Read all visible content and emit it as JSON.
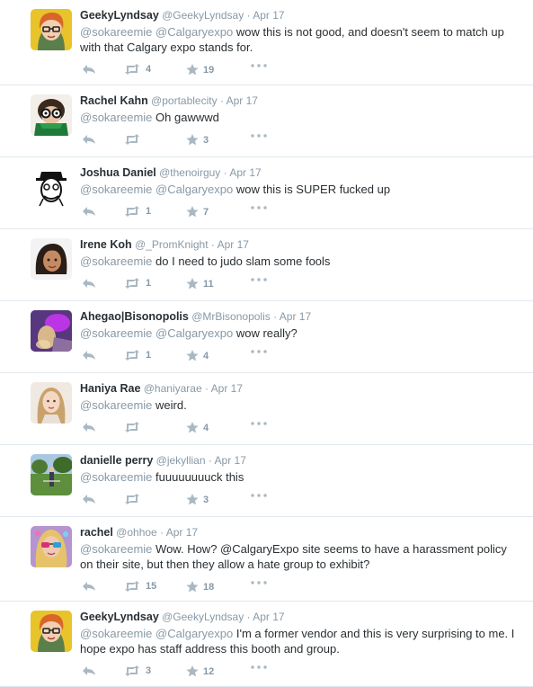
{
  "tweets": [
    {
      "name": "GeekyLyndsay",
      "handle": "@GeekyLyndsay",
      "time": "Apr 17",
      "mentions": [
        "@sokareemie",
        "@Calgaryexpo"
      ],
      "text": "wow this is not good, and doesn't seem to match up with that Calgary expo stands for.",
      "retweets": "4",
      "favorites": "19",
      "avatar": "orange-hair-glasses"
    },
    {
      "name": "Rachel Kahn",
      "handle": "@portablecity",
      "time": "Apr 17",
      "mentions": [
        "@sokareemie"
      ],
      "text": "Oh gawwwd",
      "retweets": "",
      "favorites": "3",
      "avatar": "cartoon-glasses-green"
    },
    {
      "name": "Joshua Daniel",
      "handle": "@thenoirguy",
      "time": "Apr 17",
      "mentions": [
        "@sokareemie",
        "@Calgaryexpo"
      ],
      "text": "wow this is SUPER fucked up",
      "retweets": "1",
      "favorites": "7",
      "avatar": "ink-sketch-face"
    },
    {
      "name": "Irene Koh",
      "handle": "@_PromKnight",
      "time": "Apr 17",
      "mentions": [
        "@sokareemie"
      ],
      "text": "do I need to judo slam some fools",
      "retweets": "1",
      "favorites": "11",
      "avatar": "illustrated-girl"
    },
    {
      "name": "Ahegao|Bisonopolis",
      "handle": "@MrBisonopolis",
      "time": "Apr 17",
      "mentions": [
        "@sokareemie",
        "@Calgaryexpo"
      ],
      "text": "wow really?",
      "retweets": "1",
      "favorites": "4",
      "avatar": "purple-glow"
    },
    {
      "name": "Haniya Rae",
      "handle": "@haniyarae",
      "time": "Apr 17",
      "mentions": [
        "@sokareemie"
      ],
      "text": "weird.",
      "retweets": "",
      "favorites": "4",
      "avatar": "blonde-portrait"
    },
    {
      "name": "danielle perry",
      "handle": "@jekyllian",
      "time": "Apr 17",
      "mentions": [
        "@sokareemie"
      ],
      "text": "fuuuuuuuuck this",
      "retweets": "",
      "favorites": "3",
      "avatar": "outdoor-park"
    },
    {
      "name": "rachel",
      "handle": "@ohhoe",
      "time": "Apr 17",
      "mentions": [
        "@sokareemie"
      ],
      "text": "Wow. How? @CalgaryExpo site seems to have a harassment policy on their site, but then they allow a hate group to exhibit?",
      "retweets": "15",
      "favorites": "18",
      "avatar": "colorful-sunglasses"
    },
    {
      "name": "GeekyLyndsay",
      "handle": "@GeekyLyndsay",
      "time": "Apr 17",
      "mentions": [
        "@sokareemie",
        "@Calgaryexpo"
      ],
      "text": "I'm a former vendor and this is very surprising to me. I hope expo has staff address this booth and group.",
      "retweets": "3",
      "favorites": "12",
      "avatar": "orange-hair-glasses"
    }
  ],
  "separator": "·",
  "colors": {
    "name": "#292f33",
    "meta": "#8899a6",
    "action_icon": "#aab8c2",
    "divider": "#e1e8ed"
  }
}
